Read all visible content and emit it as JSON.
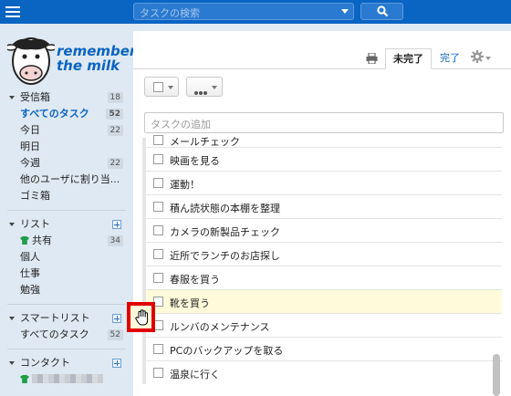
{
  "topbar": {
    "search_placeholder": "タスクの検索",
    "icons": [
      "menu-icon",
      "chevron-down-icon",
      "search-icon"
    ]
  },
  "logo": {
    "line1": "remember",
    "line2": "the milk"
  },
  "sidebar": {
    "inbox": {
      "label": "受信箱",
      "count": "18",
      "items": [
        {
          "label": "すべてのタスク",
          "count": "52",
          "active": true
        },
        {
          "label": "今日",
          "count": "22"
        },
        {
          "label": "明日",
          "count": ""
        },
        {
          "label": "今週",
          "count": "22"
        },
        {
          "label": "他のユーザに割り当...",
          "count": ""
        },
        {
          "label": "ゴミ箱",
          "count": ""
        }
      ]
    },
    "lists": {
      "label": "リスト",
      "items": [
        {
          "label": "共有",
          "count": "34"
        },
        {
          "label": "個人",
          "count": ""
        },
        {
          "label": "仕事",
          "count": ""
        },
        {
          "label": "勉強",
          "count": ""
        }
      ]
    },
    "smartlists": {
      "label": "スマートリスト",
      "items": [
        {
          "label": "すべてのタスク",
          "count": "52"
        }
      ]
    },
    "contacts": {
      "label": "コンタクト"
    }
  },
  "main": {
    "tabs": {
      "incomplete": "未完了",
      "complete": "完了"
    },
    "add_placeholder": "タスクの追加",
    "tasks": [
      "メールチェック",
      "映画を見る",
      "運動！",
      "積ん読状態の本棚を整理",
      "カメラの新製品チェック",
      "近所でランチのお店探し",
      "春服を買う",
      "靴を買う",
      "ルンバのメンテナンス",
      "PCのバックアップを取る",
      "温泉に行く"
    ],
    "highlighted_index": 7
  },
  "colors": {
    "brand": "#0a64c2",
    "highlight": "#fdfbd9",
    "annotation": "#e00000"
  }
}
